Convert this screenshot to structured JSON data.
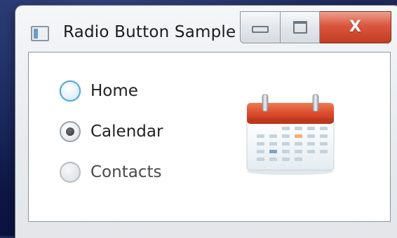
{
  "window": {
    "title": "Radio Button Sample",
    "icon": "window-app-icon",
    "caption_buttons": [
      "minimize-icon",
      "maximize-icon",
      "close-icon"
    ],
    "close_glyph": "X"
  },
  "radio_group": {
    "options": [
      {
        "label": "Home",
        "selected": false,
        "state": "hover"
      },
      {
        "label": "Calendar",
        "selected": true,
        "state": "normal"
      },
      {
        "label": "Contacts",
        "selected": false,
        "state": "normal"
      }
    ]
  },
  "preview": {
    "icon": "calendar-icon"
  },
  "colors": {
    "close_button": "#c8452c",
    "hover_ring": "#5aa6d6",
    "calendar_header": "#d8482a",
    "background": "#142052"
  }
}
